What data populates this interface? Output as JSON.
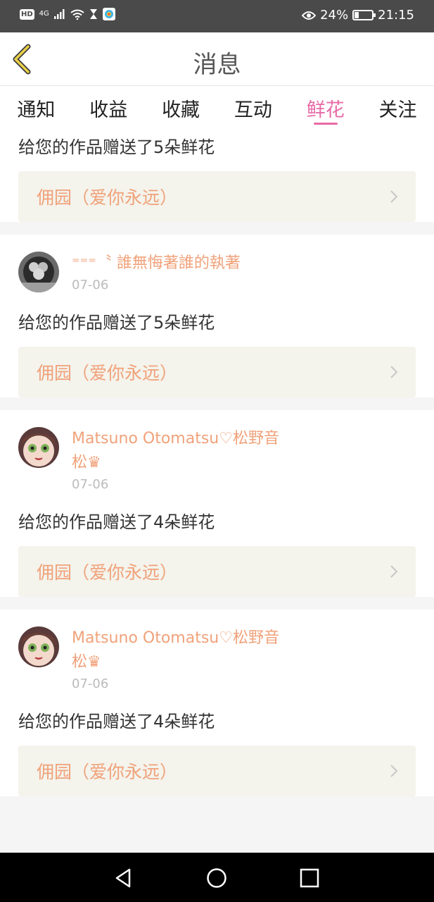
{
  "status_bar": {
    "hd": "HD",
    "network": "4G",
    "battery_pct_text": "24%",
    "battery_level": 0.24,
    "time": "21:15"
  },
  "header": {
    "title": "消息",
    "back_icon": "chevron-left-icon"
  },
  "tabs": [
    {
      "label": "通知",
      "active": false
    },
    {
      "label": "收益",
      "active": false
    },
    {
      "label": "收藏",
      "active": false
    },
    {
      "label": "互动",
      "active": false
    },
    {
      "label": "鲜花",
      "active": true
    },
    {
      "label": "关注",
      "active": false
    }
  ],
  "colors": {
    "accent": "#e86aa6",
    "name": "#f0a27a",
    "work_bg": "#f4f3ec"
  },
  "notifications": [
    {
      "message": "给您的作品赠送了5朵鲜花",
      "work": "佣园（爱你永远）"
    },
    {
      "user": "⁼⁼⁼〝 誰無悔著誰的執著",
      "date": "07-06",
      "message": "给您的作品赠送了5朵鲜花",
      "work": "佣园（爱你永远）"
    },
    {
      "user": "Matsuno Otomatsu♡松野音松♛",
      "date": "07-06",
      "message": "给您的作品赠送了4朵鲜花",
      "work": "佣园（爱你永远）"
    },
    {
      "user": "Matsuno Otomatsu♡松野音松♛",
      "date": "07-06",
      "message": "给您的作品赠送了4朵鲜花",
      "work": "佣园（爱你永远）"
    }
  ]
}
